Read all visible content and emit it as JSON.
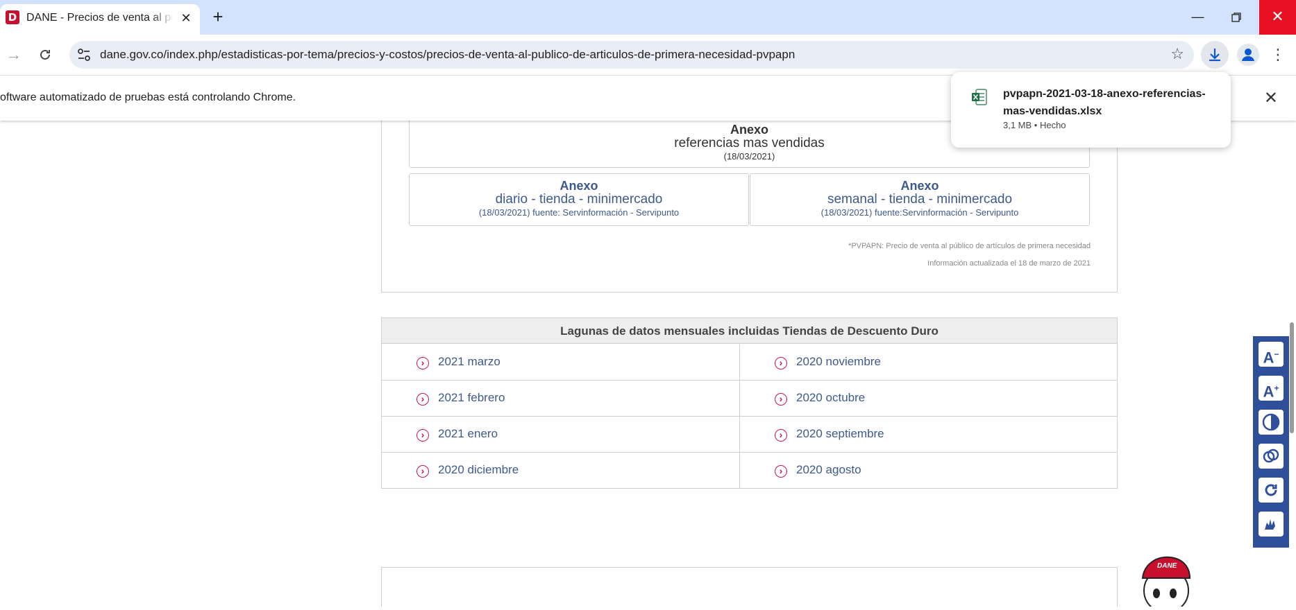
{
  "browser": {
    "tab_title": "DANE - Precios de venta al públ",
    "url": "dane.gov.co/index.php/estadisticas-por-tema/precios-y-costos/precios-de-venta-al-publico-de-articulos-de-primera-necesidad-pvpapn",
    "infobar_text": "oftware automatizado de pruebas está controlando Chrome.",
    "favicon_letter": "D"
  },
  "download": {
    "filename": "pvpapn-2021-03-18-anexo-referencias-mas-vendidas.xlsx",
    "status": "3,1 MB • Hecho"
  },
  "annex_main": {
    "title": "Anexo",
    "subtitle": "referencias mas vendidas",
    "date": "(18/03/2021)"
  },
  "annex_diario": {
    "title": "Anexo",
    "subtitle": "diario - tienda - minimercado",
    "date": "(18/03/2021) fuente: Servinformación - Servipunto"
  },
  "annex_semanal": {
    "title": "Anexo",
    "subtitle": "semanal - tienda - minimercado",
    "date": "(18/03/2021) fuente:Servinformación - Servipunto"
  },
  "notes": {
    "definition": "*PVPAPN: Precio de venta al público de artículos de primera necesidad",
    "updated": "Información actualizada el 18 de marzo de 2021"
  },
  "lagunas": {
    "header": "Lagunas de datos mensuales incluidas Tiendas de Descuento Duro",
    "left": [
      "2021 marzo",
      "2021 febrero",
      "2021 enero",
      "2020 diciembre"
    ],
    "right": [
      "2020 noviembre",
      "2020 octubre",
      "2020 septiembre",
      "2020 agosto"
    ]
  },
  "mascot_text": "DANE",
  "colors": {
    "accent_blue": "#3d5a8a",
    "chevron_pink": "#c2185b",
    "toolbar_blue": "#2f4f9b",
    "tabstrip": "#d3e3fd"
  }
}
